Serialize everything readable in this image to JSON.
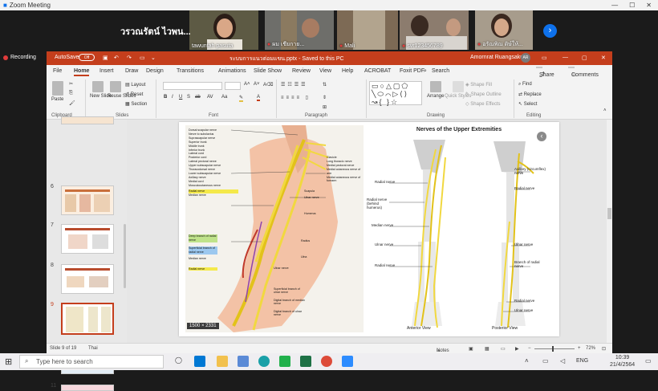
{
  "zoom": {
    "window_title": "Zoom Meeting",
    "big_name": "วรวณรัตน์ ไวพน...",
    "participants": [
      {
        "name": "tawuntah pasuta"
      },
      {
        "name": "ผม เชียกาย..."
      },
      {
        "name": "Mali"
      },
      {
        "name": "svr123456789"
      },
      {
        "name": "อรัณพิณ ดิษ์ให้..."
      }
    ],
    "recording": "Recording",
    "next_icon": "›"
  },
  "ppt": {
    "autosave_label": "AutoSave",
    "autosave_state": "Off",
    "file_title": "ระบบการแนวต่อมแขน.pptx  -  Saved to this PC",
    "user_name": "Amornrat Ruangsakul",
    "user_initials": "AR",
    "tabs": [
      "File",
      "Home",
      "Insert",
      "Draw",
      "Design",
      "Transitions",
      "Animations",
      "Slide Show",
      "Review",
      "View",
      "Help",
      "ACROBAT",
      "Foxit PDF"
    ],
    "search": "Search",
    "share": "Share",
    "comments": "Comments",
    "ribbon": {
      "paste": "Paste",
      "new_slide": "New Slide",
      "reuse_slides": "Reuse Slides",
      "layout": "Layout",
      "reset": "Reset",
      "section": "Section",
      "arrange": "Arrange",
      "quick_styles": "Quick Styles",
      "shape_fill": "Shape Fill",
      "shape_outline": "Shape Outline",
      "shape_effects": "Shape Effects",
      "find": "Find",
      "replace": "Replace",
      "select": "Select",
      "groups": [
        "Clipboard",
        "Slides",
        "Font",
        "Paragraph",
        "Drawing",
        "Editing"
      ]
    },
    "slide_numbers": [
      "6",
      "7",
      "8",
      "9",
      "10",
      "11"
    ],
    "slide_right_title": "Nerves of the Upper Extremities",
    "left_labels": [
      "Dorsal scapular nerve",
      "Nerve to subclavius",
      "Suprascapular nerve",
      "Superior trunk",
      "Middle trunk",
      "Inferior trunk",
      "Lateral cord",
      "Posterior cord",
      "Lateral pectoral nerve",
      "Upper subscapular nerve",
      "Thoracodorsal nerve",
      "Lower subscapular nerve",
      "Axillary nerve",
      "Medial cord",
      "Musculocutaneous nerve",
      "Radial nerve",
      "Median nerve",
      "Deep branch of radial nerve",
      "Superficial branch of radial nerve",
      "Median nerve",
      "Radial nerve"
    ],
    "right_labels": [
      "Clavicle",
      "Long thoracic nerve",
      "Medial pectoral nerve",
      "Medial cutaneous nerve of arm",
      "Medial cutaneous nerve of forearm",
      "Scapula",
      "Ulnar nerve",
      "Humerus",
      "Radius",
      "Ulna",
      "Ulnar nerve",
      "Superficial branch of ulnar nerve",
      "Digital branch of median nerve",
      "Digital branch of ulnar nerve"
    ],
    "anterior_labels": [
      "Radial nerve",
      "Radial nerve (behind humerus)",
      "Median nerve",
      "Ulnar nerve",
      "Radial nerve"
    ],
    "posterior_labels": [
      "Axillary (circumflex) nerve",
      "Radial nerve",
      "Ulnar nerve",
      "Branch of radial nerve",
      "Radial nerve",
      "Ulnar nerve"
    ],
    "anterior_view": "Anterior View",
    "posterior_view": "Posterior View",
    "img_size": "1500 × 2331",
    "status_slide": "Slide 9 of 19",
    "status_lang": "Thai",
    "status_notes": "Notes",
    "zoom_level": "72%"
  },
  "taskbar": {
    "search_placeholder": "Type here to search",
    "time": "10:39",
    "date": "21/4/2564",
    "lang": "ENG"
  }
}
